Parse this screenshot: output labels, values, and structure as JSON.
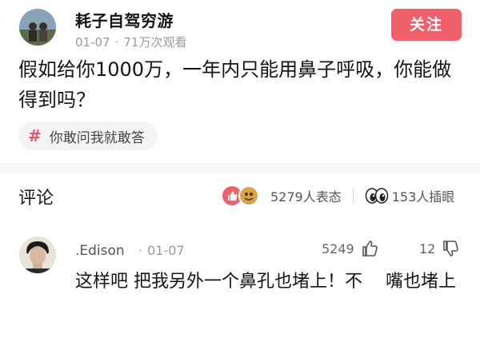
{
  "post": {
    "author": "耗子自驾穷游",
    "date": "01-07",
    "views": "71万次观看",
    "follow_label": "关注",
    "question": "假如给你1000万，一年内只能用鼻子呼吸，你能做得到吗？",
    "topic": "你敢问我就敢答"
  },
  "comments_section": {
    "title": "评论",
    "reactions_text": "5279人表态",
    "viewers_text": "153人插眼"
  },
  "comment": {
    "username": ".Edison",
    "date": "01-07",
    "likes": "5249",
    "dislikes": "12",
    "text": "这样吧 把我另外一个鼻孔也堵上！不　 嘴也堵上"
  },
  "colors": {
    "accent": "#f0606b",
    "topic_hash": "#e8546a"
  }
}
